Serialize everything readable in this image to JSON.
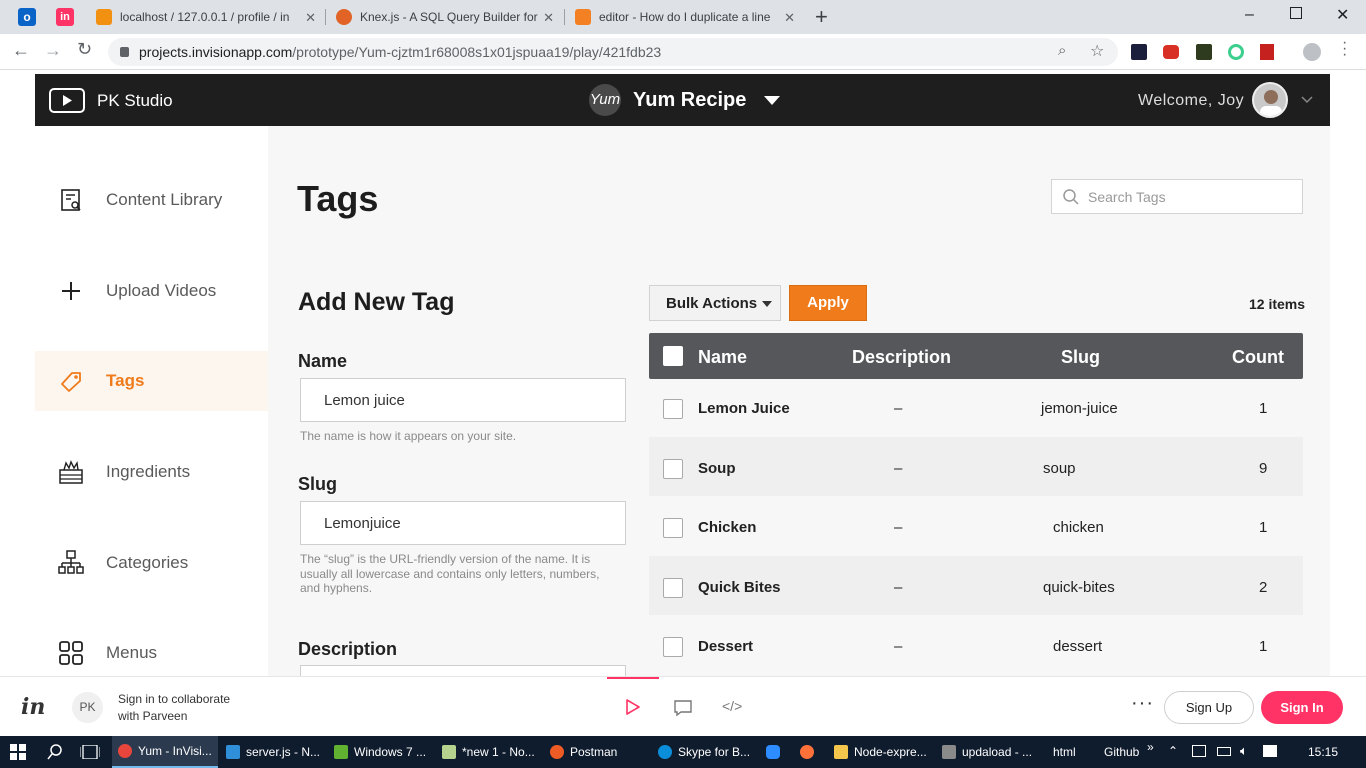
{
  "browser": {
    "tabs": [
      {
        "title": "localhost / 127.0.0.1 / profile / in",
        "active": false
      },
      {
        "title": "Knex.js - A SQL Query Builder for",
        "active": false
      },
      {
        "title": "editor - How do I duplicate a line",
        "active": false
      }
    ],
    "url_host": "projects.invisionapp.com",
    "url_path": "/prototype/Yum-cjztm1r68008s1x01jspuaa19/play/421fdb23"
  },
  "header": {
    "studio": "PK Studio",
    "logo_text": "Yum",
    "app_name": "Yum Recipe",
    "welcome": "Welcome, Joy"
  },
  "sidebar": {
    "items": [
      {
        "label": "Content Library",
        "icon": "content-library-icon"
      },
      {
        "label": "Upload Videos",
        "icon": "plus-icon"
      },
      {
        "label": "Tags",
        "icon": "tag-icon",
        "active": true
      },
      {
        "label": "Ingredients",
        "icon": "ingredients-icon"
      },
      {
        "label": "Categories",
        "icon": "categories-icon"
      },
      {
        "label": "Menus",
        "icon": "menus-icon"
      }
    ]
  },
  "page": {
    "title": "Tags",
    "search_placeholder": "Search Tags"
  },
  "form": {
    "heading": "Add New Tag",
    "name_label": "Name",
    "name_value": "Lemon juice",
    "name_help": "The name is how it appears on your site.",
    "slug_label": "Slug",
    "slug_value": "Lemonjuice",
    "slug_help": [
      "The “slug” is the URL-friendly version of the name. It is",
      "usually all lowercase and contains only letters, numbers,",
      "and hyphens."
    ],
    "description_label": "Description"
  },
  "table": {
    "bulk_actions": "Bulk Actions",
    "apply": "Apply",
    "item_count": "12 items",
    "columns": [
      "Name",
      "Description",
      "Slug",
      "Count"
    ],
    "rows": [
      {
        "name": "Lemon Juice",
        "description": "–",
        "slug": "jemon-juice",
        "count": "1"
      },
      {
        "name": "Soup",
        "description": "–",
        "slug": "soup",
        "count": "9"
      },
      {
        "name": "Chicken",
        "description": "–",
        "slug": "chicken",
        "count": "1"
      },
      {
        "name": "Quick Bites",
        "description": "–",
        "slug": "quick-bites",
        "count": "2"
      },
      {
        "name": "Dessert",
        "description": "–",
        "slug": "dessert",
        "count": "1"
      }
    ]
  },
  "invision": {
    "avatar": "PK",
    "collab_line1": "Sign in to collaborate",
    "collab_line2": "with Parveen",
    "signup": "Sign Up",
    "signin": "Sign In"
  },
  "taskbar": {
    "items": [
      "Yum - InVisi...",
      "server.js - N...",
      "Windows 7 ...",
      "*new 1 - No...",
      "Postman",
      "Skype for B...",
      "Node-expre...",
      "updaload - ...",
      "html",
      "Github"
    ],
    "time": "15:15"
  },
  "colors": {
    "accent": "#ef7b1a",
    "header_bg": "#1e1e1e",
    "table_header": "#55575b",
    "signin": "#ff3366"
  }
}
